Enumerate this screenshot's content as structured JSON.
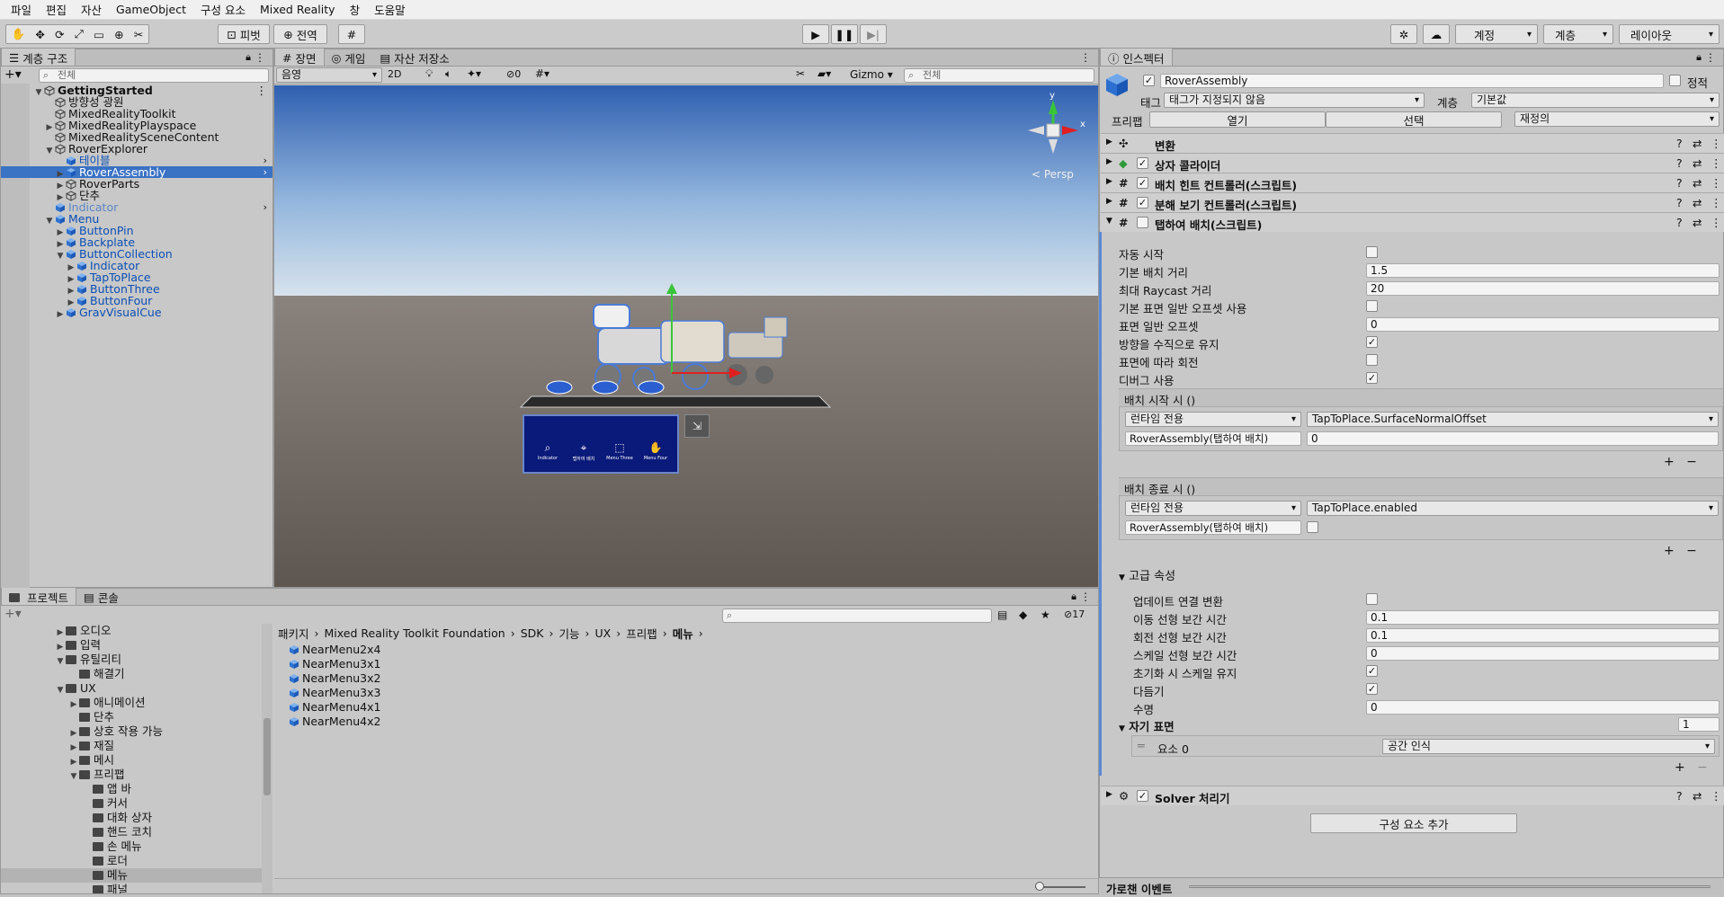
{
  "menu": [
    "파일",
    "편집",
    "자산",
    "GameObject",
    "구성 요소",
    "Mixed Reality",
    "창",
    "도움말"
  ],
  "toolbar": {
    "pivot": "피벗",
    "global": "전역",
    "account": "계정",
    "layers": "계층",
    "layout": "레이아웃"
  },
  "hierarchy": {
    "tab": "계층 구조",
    "search_placeholder": "전체",
    "items": [
      {
        "label": "GettingStarted",
        "depth": 0,
        "exp": "▼",
        "bold": true,
        "icon": "scene"
      },
      {
        "label": "방향성 광원",
        "depth": 1,
        "exp": "",
        "icon": "cube"
      },
      {
        "label": "MixedRealityToolkit",
        "depth": 1,
        "exp": "",
        "icon": "cube"
      },
      {
        "label": "MixedRealityPlayspace",
        "depth": 1,
        "exp": "▶",
        "icon": "cube"
      },
      {
        "label": "MixedRealitySceneContent",
        "depth": 1,
        "exp": "",
        "icon": "cube"
      },
      {
        "label": "RoverExplorer",
        "depth": 1,
        "exp": "▼",
        "icon": "cube"
      },
      {
        "label": "테이블",
        "depth": 2,
        "exp": "",
        "icon": "prefab",
        "blue": true
      },
      {
        "label": "RoverAssembly",
        "depth": 2,
        "exp": "▶",
        "icon": "prefab",
        "selected": true
      },
      {
        "label": "RoverParts",
        "depth": 2,
        "exp": "▶",
        "icon": "cube"
      },
      {
        "label": "단추",
        "depth": 2,
        "exp": "▶",
        "icon": "cube"
      },
      {
        "label": "Indicator",
        "depth": 1,
        "exp": "",
        "icon": "prefab",
        "faded": true
      },
      {
        "label": "Menu",
        "depth": 1,
        "exp": "▼",
        "icon": "prefab",
        "blue": true
      },
      {
        "label": "ButtonPin",
        "depth": 2,
        "exp": "▶",
        "icon": "prefab",
        "blue": true
      },
      {
        "label": "Backplate",
        "depth": 2,
        "exp": "▶",
        "icon": "prefab",
        "blue": true
      },
      {
        "label": "ButtonCollection",
        "depth": 2,
        "exp": "▼",
        "icon": "prefab",
        "blue": true
      },
      {
        "label": "Indicator",
        "depth": 3,
        "exp": "▶",
        "icon": "prefab",
        "blue": true
      },
      {
        "label": "TapToPlace",
        "depth": 3,
        "exp": "▶",
        "icon": "prefab",
        "blue": true
      },
      {
        "label": "ButtonThree",
        "depth": 3,
        "exp": "▶",
        "icon": "prefab",
        "blue": true
      },
      {
        "label": "ButtonFour",
        "depth": 3,
        "exp": "▶",
        "icon": "prefab",
        "blue": true
      },
      {
        "label": "GravVisualCue",
        "depth": 2,
        "exp": "▶",
        "icon": "prefab",
        "blue": true
      }
    ]
  },
  "scene": {
    "tabs": [
      "장면",
      "게임",
      "자산 저장소"
    ],
    "shading": "음영",
    "mode2d": "2D",
    "hidden_count": "0",
    "gizmo": "Gizmo",
    "search_placeholder": "전체",
    "persp": "< Persp",
    "menu_buttons": [
      "Indicator",
      "탭하여 배치",
      "Menu Three",
      "Menu Four"
    ]
  },
  "project": {
    "tabs": [
      "프로젝트",
      "콘솔"
    ],
    "count": "17",
    "breadcrumb": [
      "패키지",
      "Mixed Reality Toolkit Foundation",
      "SDK",
      "기능",
      "UX",
      "프리팹",
      "메뉴"
    ],
    "tree": [
      {
        "label": "오디오",
        "depth": 4,
        "exp": "▶"
      },
      {
        "label": "입력",
        "depth": 4,
        "exp": "▶"
      },
      {
        "label": "유틸리티",
        "depth": 4,
        "exp": "▼"
      },
      {
        "label": "해결기",
        "depth": 5,
        "exp": ""
      },
      {
        "label": "UX",
        "depth": 4,
        "exp": "▼"
      },
      {
        "label": "애니메이션",
        "depth": 5,
        "exp": "▶"
      },
      {
        "label": "단추",
        "depth": 5,
        "exp": ""
      },
      {
        "label": "상호 작용 가능",
        "depth": 5,
        "exp": "▶"
      },
      {
        "label": "재질",
        "depth": 5,
        "exp": "▶"
      },
      {
        "label": "메시",
        "depth": 5,
        "exp": "▶"
      },
      {
        "label": "프리팹",
        "depth": 5,
        "exp": "▼"
      },
      {
        "label": "앱 바",
        "depth": 6,
        "exp": ""
      },
      {
        "label": "커서",
        "depth": 6,
        "exp": ""
      },
      {
        "label": "대화 상자",
        "depth": 6,
        "exp": ""
      },
      {
        "label": "핸드 코치",
        "depth": 6,
        "exp": ""
      },
      {
        "label": "손 메뉴",
        "depth": 6,
        "exp": ""
      },
      {
        "label": "로더",
        "depth": 6,
        "exp": ""
      },
      {
        "label": "메뉴",
        "depth": 6,
        "exp": "",
        "selected": true
      },
      {
        "label": "패널",
        "depth": 6,
        "exp": ""
      }
    ],
    "files": [
      "NearMenu2x4",
      "NearMenu3x1",
      "NearMenu3x2",
      "NearMenu3x3",
      "NearMenu4x1",
      "NearMenu4x2"
    ]
  },
  "inspector": {
    "tab": "인스펙터",
    "object_name": "RoverAssembly",
    "static": "정적",
    "tag_label": "태그",
    "tag_value": "태그가 지정되지 않음",
    "layer_label": "계층",
    "layer_value": "기본값",
    "prefab_label": "프리팹",
    "open": "열기",
    "select": "선택",
    "override": "재정의",
    "components": [
      {
        "name": "변환",
        "check": false
      },
      {
        "name": "상자 콜라이더",
        "check": true
      },
      {
        "name": "배치 힌트 컨트롤러(스크립트)",
        "check": true
      },
      {
        "name": "분해 보기 컨트롤러(스크립트)",
        "check": true
      },
      {
        "name": "탭하여 배치(스크립트)",
        "check": false,
        "expanded": true
      }
    ],
    "props": [
      {
        "label": "자동 시작",
        "type": "check",
        "value": ""
      },
      {
        "label": "기본 배치 거리",
        "type": "text",
        "value": "1.5"
      },
      {
        "label": "최대 Raycast 거리",
        "type": "text",
        "value": "20"
      },
      {
        "label": "기본 표면 일반 오프셋 사용",
        "type": "check",
        "value": ""
      },
      {
        "label": "표면 일반 오프셋",
        "type": "text",
        "value": "0"
      },
      {
        "label": "방향을 수직으로 유지",
        "type": "check",
        "value": "✓"
      },
      {
        "label": "표면에 따라 회전",
        "type": "check",
        "value": ""
      },
      {
        "label": "디버그 사용",
        "type": "check",
        "value": "✓"
      }
    ],
    "event_start": {
      "title": "배치 시작 시 ()",
      "runtime": "런타임 전용",
      "func": "TapToPlace.SurfaceNormalOffset",
      "obj": "RoverAssembly(탭하여 배치)",
      "arg": "0"
    },
    "event_stop": {
      "title": "배치 종료 시 ()",
      "runtime": "런타임 전용",
      "func": "TapToPlace.enabled",
      "obj": "RoverAssembly(탭하여 배치)"
    },
    "advanced": "고급 속성",
    "adv_props": [
      {
        "label": "업데이트 연결 변환",
        "type": "check",
        "value": ""
      },
      {
        "label": "이동 선형 보간 시간",
        "type": "text",
        "value": "0.1"
      },
      {
        "label": "회전 선형 보간 시간",
        "type": "text",
        "value": "0.1"
      },
      {
        "label": "스케일 선형 보간 시간",
        "type": "text",
        "value": "0"
      },
      {
        "label": "초기화 시 스케일 유지",
        "type": "check",
        "value": "✓"
      },
      {
        "label": "다듬기",
        "type": "check",
        "value": "✓"
      },
      {
        "label": "수명",
        "type": "text",
        "value": "0"
      }
    ],
    "magnetic": "자기 표면",
    "magnetic_count": "1",
    "element_label": "요소 0",
    "element_value": "공간 인식",
    "solver": "Solver 처리기",
    "add_component": "구성 요소 추가",
    "footer": "가로챈 이벤트"
  }
}
